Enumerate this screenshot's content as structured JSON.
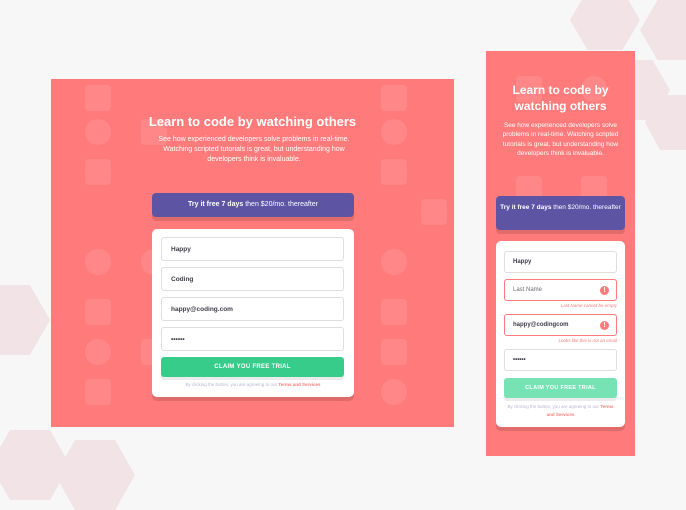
{
  "headline": "Learn to code by watching others",
  "description": "See how experienced developers solve problems in real-time. Watching scripted tutorials is great, but understanding how developers think is invaluable.",
  "trial": {
    "bold": "Try it free 7 days",
    "rest": "then $20/mo. thereafter"
  },
  "desktop_form": {
    "first_name": "Happy",
    "last_name": "Coding",
    "email": "happy@coding.com",
    "password": "••••••"
  },
  "mobile_form": {
    "first_name": "Happy",
    "last_name_placeholder": "Last Name",
    "last_name_error": "Last Name cannot be empty",
    "email": "happy@codingcom",
    "email_error": "Looks like this is not an email",
    "password": "••••••",
    "error_icon": "!"
  },
  "cta_label": "CLAIM YOU FREE TRIAL",
  "terms": {
    "text": "By clicking the button, you are agreeing to our",
    "link": "Terms and Services"
  },
  "colors": {
    "red": "#ff7a7a",
    "blue": "#5e54a4",
    "green": "#38cc8b"
  },
  "icons": [
    "exclamation-circle-icon"
  ]
}
